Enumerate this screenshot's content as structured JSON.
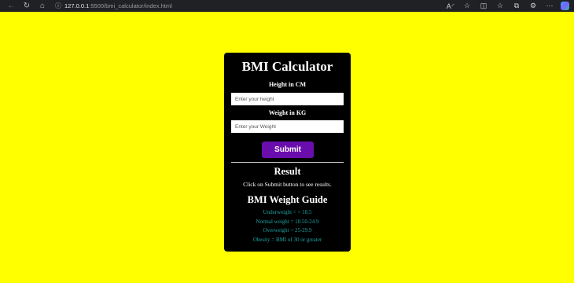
{
  "browser": {
    "url_host": "127.0.0.1",
    "url_path": ":5500/bmi_calculator/index.html"
  },
  "app": {
    "title": "BMI Calculator",
    "height_label": "Height in CM",
    "height_placeholder": "Enter your height",
    "weight_label": "Weight in KG",
    "weight_placeholder": "Enter your Weight",
    "submit_label": "Submit",
    "result_heading": "Result",
    "result_text": "Click on Submit button to see results.",
    "guide_heading": "BMI Weight Guide",
    "guide": [
      "Underweight = < 18.5",
      "Normal weight = 18.50-24.9",
      "Overweight = 25-29.9",
      "Obesity = BMI of 30 or greater"
    ]
  },
  "colors": {
    "page_background": "#ffff00",
    "card_background": "#000000",
    "submit_button": "#6a0dad",
    "guide_text": "#1fa3a3"
  },
  "icons": {
    "back": "arrow-left-icon",
    "refresh": "refresh-icon",
    "home": "home-icon",
    "site_info": "info-icon",
    "read_aloud": "read-aloud-icon",
    "favorite": "star-icon",
    "split_screen": "split-screen-icon",
    "favorites": "favorites-icon",
    "collections": "collections-icon",
    "extensions": "extensions-icon",
    "more": "more-icon",
    "copilot": "copilot-icon"
  }
}
